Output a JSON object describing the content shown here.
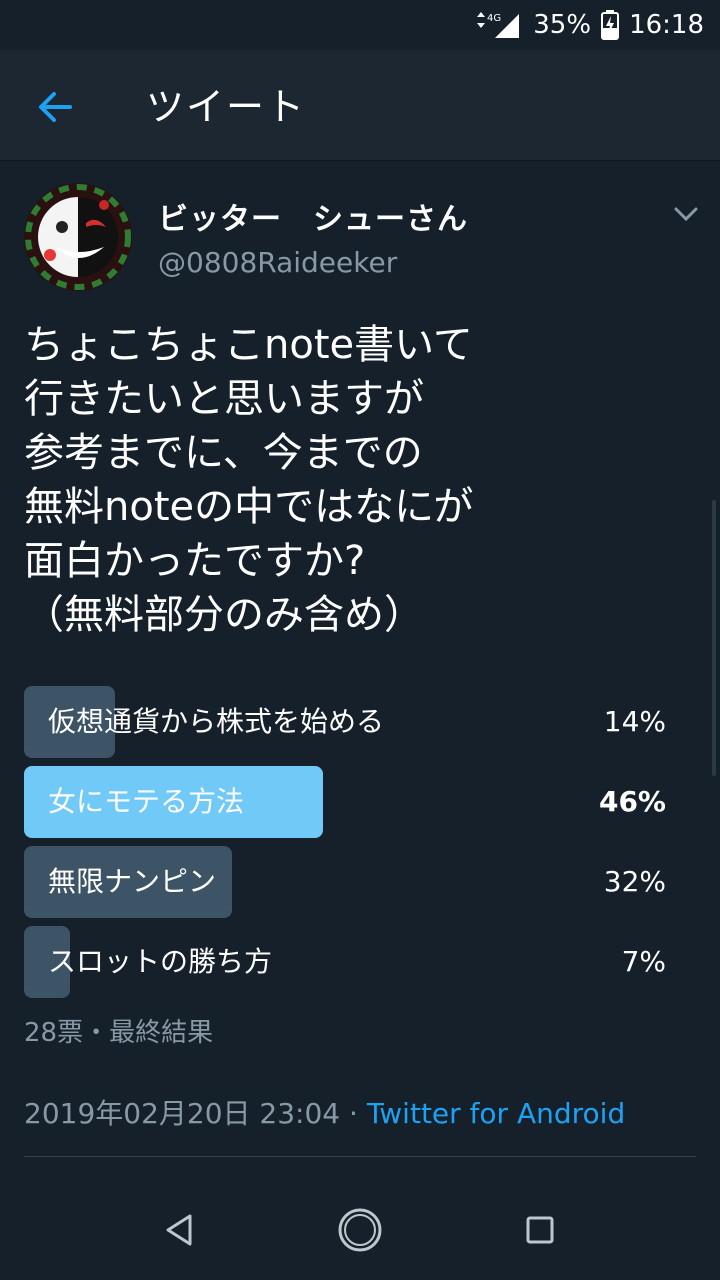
{
  "status_bar": {
    "network": "4G",
    "battery": "35%",
    "time": "16:18"
  },
  "header": {
    "title": "ツイート"
  },
  "tweet": {
    "display_name": "ビッター　シューさん",
    "handle": "@0808Raideeker",
    "text_lines": [
      "ちょこちょこnote書いて",
      "行きたいと思いますが",
      "参考までに、今までの",
      "無料noteの中ではなにが",
      "面白かったですか?",
      "（無料部分のみ含め）"
    ],
    "poll": {
      "options": [
        {
          "label": "仮想通貨から株式を始める",
          "percent_text": "14%",
          "fraction": 0.14,
          "winner": false
        },
        {
          "label": "女にモテる方法",
          "percent_text": "46%",
          "fraction": 0.46,
          "winner": true
        },
        {
          "label": "無限ナンピン",
          "percent_text": "32%",
          "fraction": 0.32,
          "winner": false
        },
        {
          "label": "スロットの勝ち方",
          "percent_text": "7%",
          "fraction": 0.07,
          "winner": false
        }
      ],
      "summary": "28票・最終結果"
    },
    "timestamp": "2019年02月20日 23:04",
    "separator": " · ",
    "source": "Twitter for Android"
  },
  "colors": {
    "background": "#15202b",
    "accent": "#1da1f2",
    "poll_winner": "#71c9f8",
    "poll_bar": "#3d5466",
    "secondary_text": "#8899a6"
  },
  "icons": {
    "back": "arrow-left-icon",
    "menu": "chevron-down-icon",
    "nav_back": "triangle-back-icon",
    "nav_home": "circle-home-icon",
    "nav_recents": "square-recents-icon"
  }
}
